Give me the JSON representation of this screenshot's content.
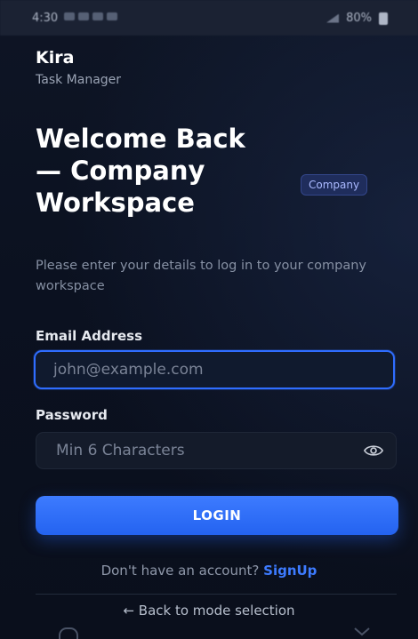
{
  "status_bar": {
    "time": "4:30",
    "battery": "80%"
  },
  "brand": {
    "name": "Kira",
    "subtitle": "Task Manager"
  },
  "welcome": {
    "title": "Welcome Back — Company Workspace",
    "badge": "Company",
    "subtitle": "Please enter your details to log in to your company workspace"
  },
  "form": {
    "email_label": "Email Address",
    "email_placeholder": "john@example.com",
    "password_label": "Password",
    "password_placeholder": "Min 6 Characters",
    "login_label": "LOGIN"
  },
  "footer": {
    "signup_prompt": "Don't have an account?",
    "signup_link": "SignUp",
    "back_link": "← Back to mode selection"
  },
  "icons": {
    "eye": "eye-icon",
    "signal": "signal-icon",
    "battery": "battery-icon"
  },
  "colors": {
    "accent": "#2f6dff",
    "background": "#0b1120",
    "badge_bg": "#1f2d5c"
  }
}
